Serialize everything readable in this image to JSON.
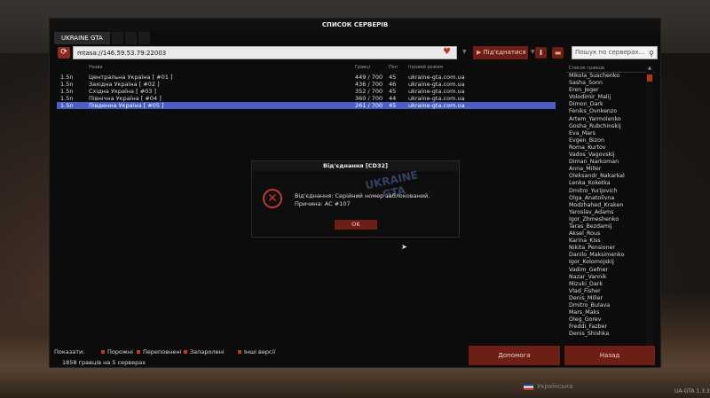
{
  "window": {
    "title": "СПИСОК СЕРВЕРІВ",
    "tabs": [
      "UKRAINE GTA",
      "",
      "",
      ""
    ]
  },
  "toolbar": {
    "address_value": "mtasa://146.59.53.79:22003",
    "connect_label": "Під'єднатися",
    "search_placeholder": "Пошук по серверах..."
  },
  "server_list": {
    "columns": [
      "Назва",
      "Гравці",
      "Пінг",
      "Ігровий режим"
    ],
    "rows": [
      {
        "version": "1.5n",
        "name": "Центральна Україна [ #01 ]",
        "players": "449 / 700",
        "ping": "45",
        "mode": "ukraine-gta.com.ua",
        "selected": false
      },
      {
        "version": "1.5n",
        "name": "Західна Україна [ #02 ]",
        "players": "436 / 700",
        "ping": "46",
        "mode": "ukraine-gta.com.ua",
        "selected": false
      },
      {
        "version": "1.5n",
        "name": "Східна Україна [ #03 ]",
        "players": "352 / 700",
        "ping": "45",
        "mode": "ukraine-gta.com.ua",
        "selected": false
      },
      {
        "version": "1.5n",
        "name": "Північна Україна [ #04 ]",
        "players": "360 / 700",
        "ping": "44",
        "mode": "ukraine-gta.com.ua",
        "selected": false
      },
      {
        "version": "1.5n",
        "name": "Південна Україна [ #05 ]",
        "players": "261 / 700",
        "ping": "45",
        "mode": "ukraine-gta.com.ua",
        "selected": true
      }
    ]
  },
  "players_panel": {
    "header": "Список гравців",
    "players": [
      "Mikola_Suschenko",
      "Sasha_Sonn",
      "Eren_Jeger",
      "Volodimir_Malij",
      "Dimon_Dark",
      "Feniks_Ovnkenzo",
      "Artem_Yarmolenko",
      "Gosha_Rubchinskij",
      "Eva_Mars",
      "Evgen_Bizon",
      "Roma_Kurtov",
      "Vados_Vagovskij",
      "Diman_Narkoman",
      "Anna_Miller",
      "Oleksandr_Nakarkal",
      "Lenka_Koketka",
      "Dmitro_Yurijovich",
      "Olga_Anatolivna",
      "Modzhahed_Kraken",
      "Yaroslav_Adams",
      "Igor_Zhmeshenko",
      "Taras_Bezdamij",
      "Aksel_Rous",
      "Karina_Kiss",
      "Nikita_Pensioner",
      "Danilo_Maksimenko",
      "Igor_Kolomojskij",
      "Vadim_Gefner",
      "Nazar_Vannik",
      "Mizuki_Dark",
      "Vlad_Fisher",
      "Denis_Miller",
      "Dmitro_Bulava",
      "Mars_Maks",
      "Oleg_Gorev",
      "Freddi_Fazber",
      "Denis_Shishka"
    ]
  },
  "filters": {
    "label": "Показати:",
    "items": [
      "Порожні",
      "Переповнені",
      "Запаролені",
      "Інші версії"
    ]
  },
  "status": {
    "player_count": "1858 гравців на 5 серверах"
  },
  "buttons": {
    "help": "Допомога",
    "back": "Назад"
  },
  "dialog": {
    "title": "Від'єднання [CD32]",
    "line1": "Від'єднання: Серійний номер заблокований.",
    "line2": "Причина: AC #107",
    "ok_label": "OK",
    "watermark": "UKRAINE GTA"
  },
  "footer": {
    "language": "Українська",
    "version": "UA-GTA 1.3.3"
  },
  "colors": {
    "accent_red": "#6d1f15",
    "selected_row": "#4a5ec3",
    "error_red": "#c0392b"
  }
}
